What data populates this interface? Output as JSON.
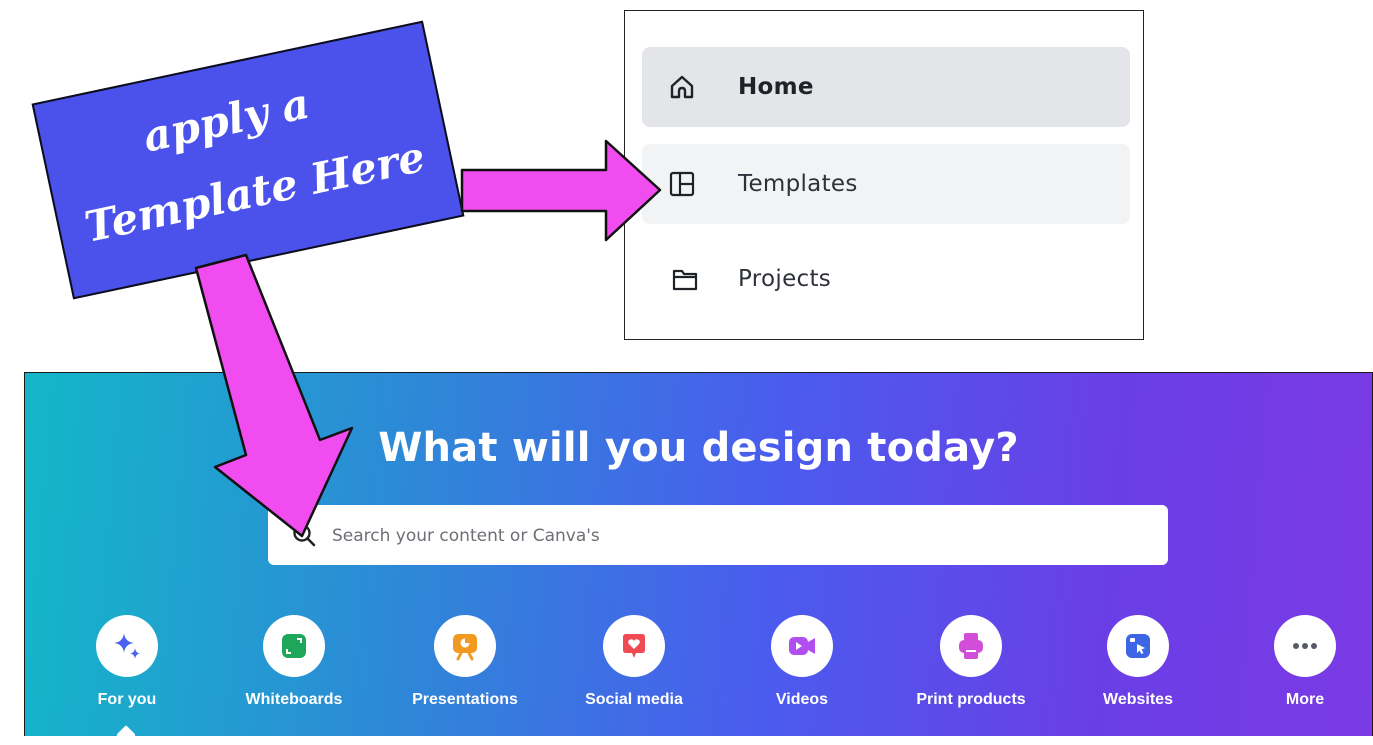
{
  "annotation": {
    "sign_line1": "apply a",
    "sign_line2": "Template Here",
    "sign_color": "#4b52ec",
    "arrow_color": "#f14cf0"
  },
  "sidebar": {
    "items": [
      {
        "label": "Home",
        "icon": "home-icon",
        "state": "active"
      },
      {
        "label": "Templates",
        "icon": "templates-icon",
        "state": "hover"
      },
      {
        "label": "Projects",
        "icon": "folder-icon",
        "state": "default"
      }
    ]
  },
  "banner": {
    "title": "What will you design today?",
    "search_placeholder": "Search your content or Canva's",
    "categories": [
      {
        "label": "For you",
        "icon": "sparkle-icon",
        "color": "#4a62f0",
        "selected": true
      },
      {
        "label": "Whiteboards",
        "icon": "whiteboard-icon",
        "color": "#1ea75a"
      },
      {
        "label": "Presentations",
        "icon": "presentation-icon",
        "color": "#f29a1f"
      },
      {
        "label": "Social media",
        "icon": "heart-icon",
        "color": "#f04a55"
      },
      {
        "label": "Videos",
        "icon": "video-icon",
        "color": "#b04ef0"
      },
      {
        "label": "Print products",
        "icon": "printer-icon",
        "color": "#d24ed8"
      },
      {
        "label": "Websites",
        "icon": "website-icon",
        "color": "#3d66e6"
      },
      {
        "label": "More",
        "icon": "more-icon",
        "color": "#555a66"
      }
    ]
  }
}
